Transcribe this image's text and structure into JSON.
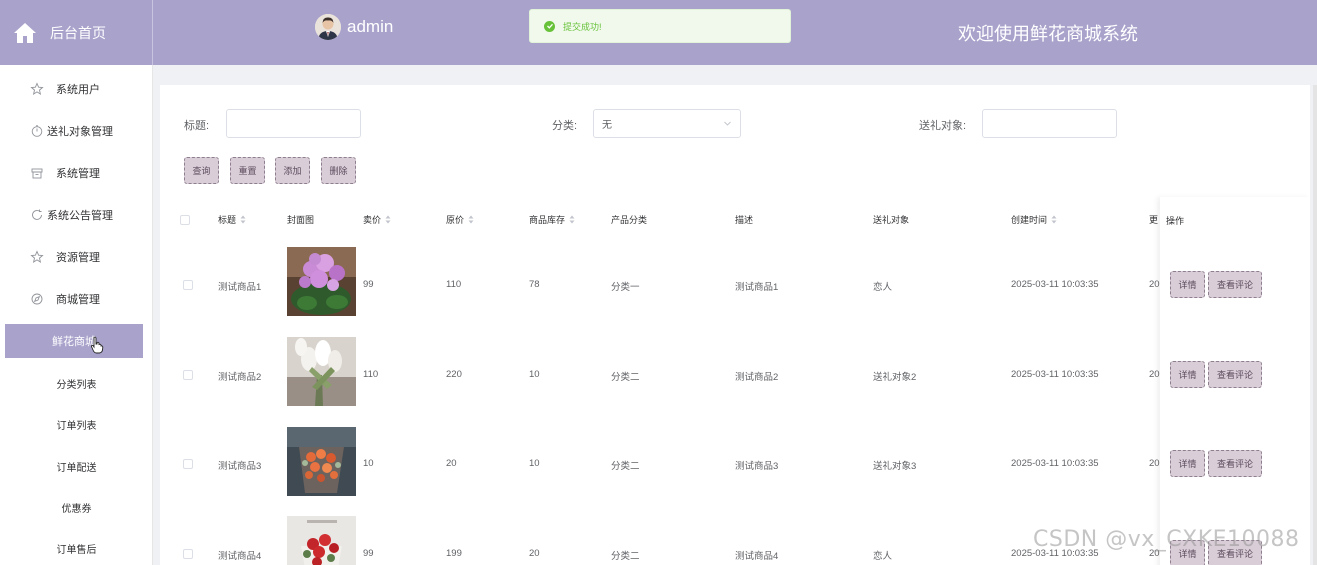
{
  "header": {
    "brand_label": "后台首页",
    "username": "admin",
    "toast_message": "提交成功!",
    "welcome_text": "欢迎使用鲜花商城系统",
    "colors": {
      "header_bg": "#a9a3cc",
      "success": "#67c23a",
      "button_bg": "#d9cdd8"
    }
  },
  "sidebar": {
    "items": [
      {
        "label": "系统用户",
        "icon": "star-icon"
      },
      {
        "label": "送礼对象管理",
        "icon": "timer-icon"
      },
      {
        "label": "系统管理",
        "icon": "box-icon"
      },
      {
        "label": "系统公告管理",
        "icon": "refresh-icon"
      },
      {
        "label": "资源管理",
        "icon": "star-icon"
      },
      {
        "label": "商城管理",
        "icon": "compass-icon"
      }
    ],
    "sub_items": [
      "鲜花商城",
      "分类列表",
      "订单列表",
      "订单配送",
      "优惠券",
      "订单售后"
    ],
    "active_sub": "鲜花商城"
  },
  "search": {
    "title_label": "标题:",
    "title_value": "",
    "category_label": "分类:",
    "category_value": "无",
    "recipient_label": "送礼对象:",
    "recipient_value": ""
  },
  "actions": {
    "query": "查询",
    "reset": "重置",
    "add": "添加",
    "delete": "删除"
  },
  "table": {
    "headers": {
      "title": "标题",
      "cover": "封面图",
      "price": "卖价",
      "original_price": "原价",
      "stock": "商品库存",
      "category": "产品分类",
      "description": "描述",
      "recipient": "送礼对象",
      "created": "创建时间",
      "updated": "更",
      "ops": "操作"
    },
    "rows": [
      {
        "title": "测试商品1",
        "price": "99",
        "original_price": "110",
        "stock": "78",
        "category": "分类一",
        "description": "测试商品1",
        "recipient": "恋人",
        "created": "2025-03-11 10:03:35",
        "updated": "20",
        "cover": "pink-flower-pot-image"
      },
      {
        "title": "测试商品2",
        "price": "110",
        "original_price": "220",
        "stock": "10",
        "category": "分类二",
        "description": "测试商品2",
        "recipient": "送礼对象2",
        "created": "2025-03-11 10:03:35",
        "updated": "20",
        "cover": "white-tulips-image"
      },
      {
        "title": "测试商品3",
        "price": "10",
        "original_price": "20",
        "stock": "10",
        "category": "分类二",
        "description": "测试商品3",
        "recipient": "送礼对象3",
        "created": "2025-03-11 10:03:35",
        "updated": "20",
        "cover": "orange-bouquet-image"
      },
      {
        "title": "测试商品4",
        "price": "99",
        "original_price": "199",
        "stock": "20",
        "category": "分类二",
        "description": "测试商品4",
        "recipient": "恋人",
        "created": "2025-03-11 10:03:35",
        "updated": "20",
        "cover": "red-rose-bouquet-image"
      }
    ],
    "row_actions": {
      "detail": "详情",
      "comments": "查看评论"
    }
  },
  "watermark": "CSDN @vx_CXKE10088"
}
